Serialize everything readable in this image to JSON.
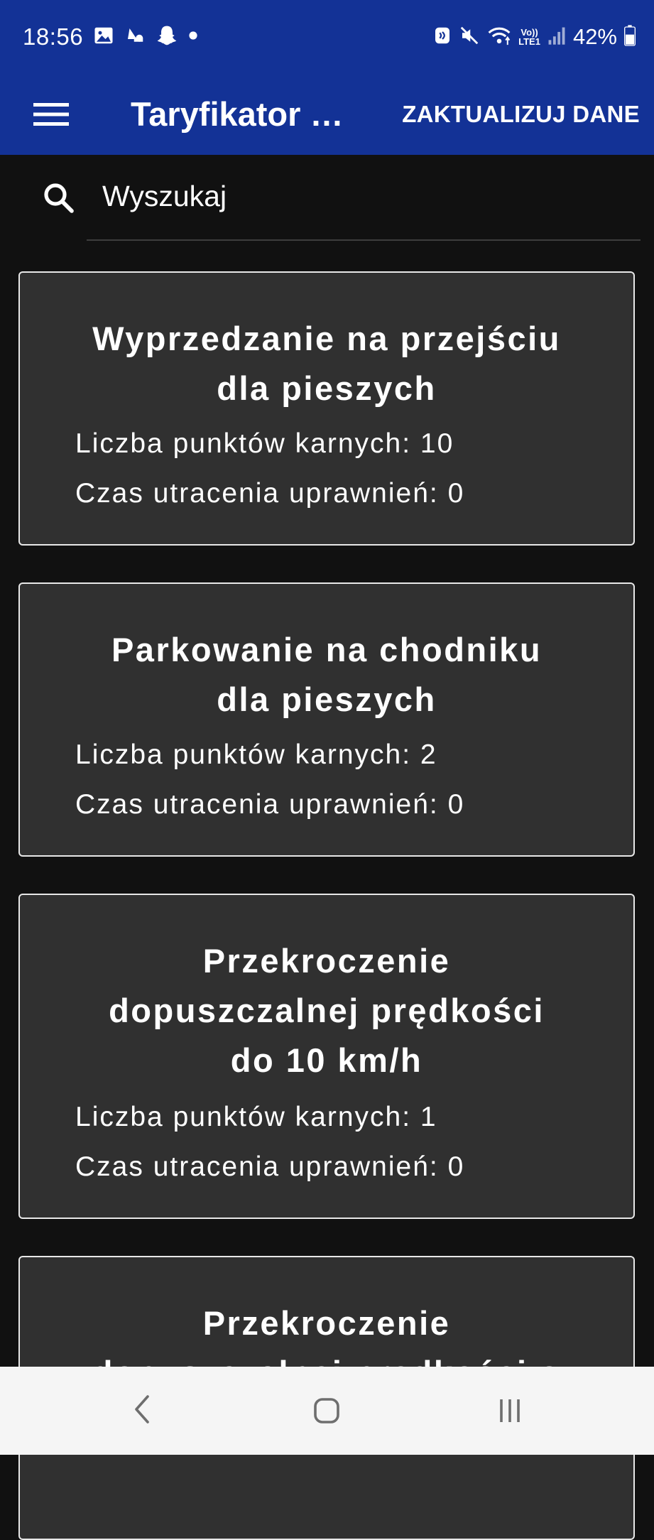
{
  "status_bar": {
    "time": "18:56",
    "battery": "42%",
    "lte_top": "Vo))",
    "lte_bottom": "LTE1",
    "icons_left": [
      "gallery-icon",
      "weather-icon",
      "snapchat-icon",
      "dot-icon"
    ],
    "icons_right": [
      "nfc-icon",
      "mute-icon",
      "wifi-icon",
      "lte-icon",
      "signal-icon",
      "battery-icon"
    ]
  },
  "app_bar": {
    "title": "Taryfikator mandatów",
    "update_label": "ZAKTUALIZUJ DANE",
    "background": "#133296"
  },
  "search": {
    "placeholder": "Wyszukaj"
  },
  "cards": [
    {
      "title_lines": [
        "Wyprzedzanie na przejściu",
        "dla pieszych"
      ],
      "points": "Liczba punktów karnych: 10",
      "suspension": "Czas utracenia uprawnień: 0"
    },
    {
      "title_lines": [
        "Parkowanie na chodniku",
        "dla pieszych"
      ],
      "points": "Liczba punktów karnych: 2",
      "suspension": "Czas utracenia uprawnień: 0"
    },
    {
      "title_lines": [
        "Przekroczenie",
        "dopuszczalnej prędkości",
        "do 10 km/h"
      ],
      "points": "Liczba punktów karnych: 1",
      "suspension": "Czas utracenia uprawnień: 0"
    },
    {
      "title_lines": [
        "Przekroczenie",
        "dopuszczalnej prędkości o"
      ],
      "points": "",
      "suspension": ""
    }
  ],
  "colors": {
    "card_background": "#303030",
    "card_border": "#e8e8e8",
    "page_background": "#111111",
    "nav_background": "#f5f5f5"
  }
}
